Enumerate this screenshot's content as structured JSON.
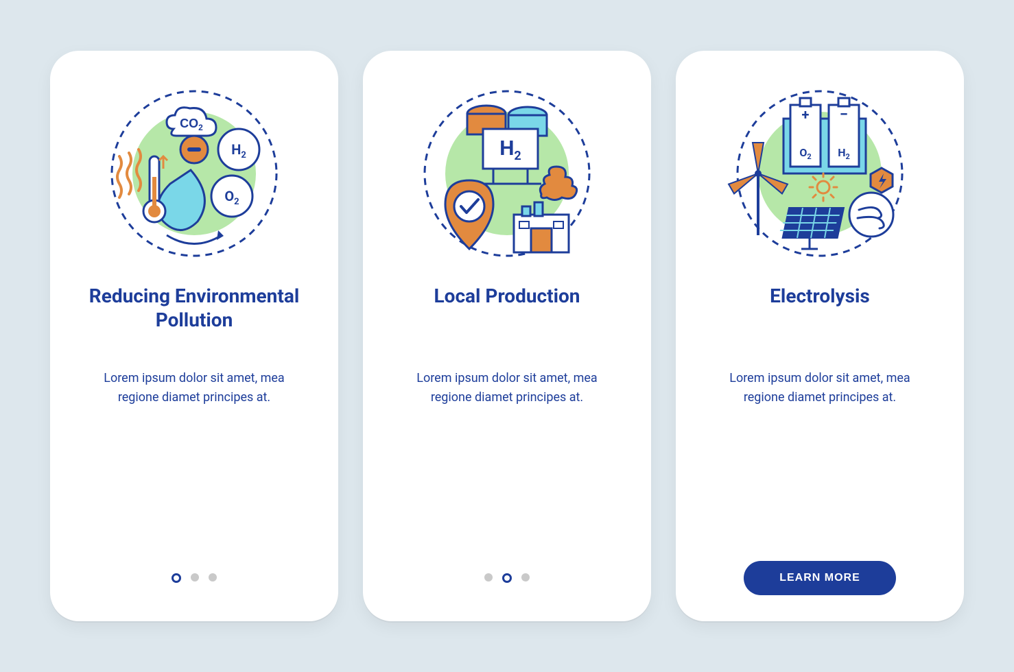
{
  "cards": [
    {
      "title": "Reducing Environmental Pollution",
      "body": "Lorem ipsum dolor sit amet, mea regione diamet principes at.",
      "activeDot": 0,
      "hasDots": true,
      "hasCta": false
    },
    {
      "title": "Local Production",
      "body": "Lorem ipsum dolor sit amet, mea regione diamet principes at.",
      "activeDot": 1,
      "hasDots": true,
      "hasCta": false
    },
    {
      "title": "Electrolysis",
      "body": "Lorem ipsum dolor sit amet, mea regione diamet principes at.",
      "activeDot": 2,
      "hasDots": false,
      "hasCta": true
    }
  ],
  "cta_label": "LEARN MORE",
  "icons": {
    "co2": "CO2",
    "h2": "H2",
    "o2": "O2",
    "plus": "+",
    "minus": "−"
  },
  "colors": {
    "primary": "#1d3d9a",
    "accent_orange": "#e28a3f",
    "accent_green": "#b6e7a8",
    "accent_cyan": "#7ad7e8",
    "bg": "#dde7ed"
  }
}
